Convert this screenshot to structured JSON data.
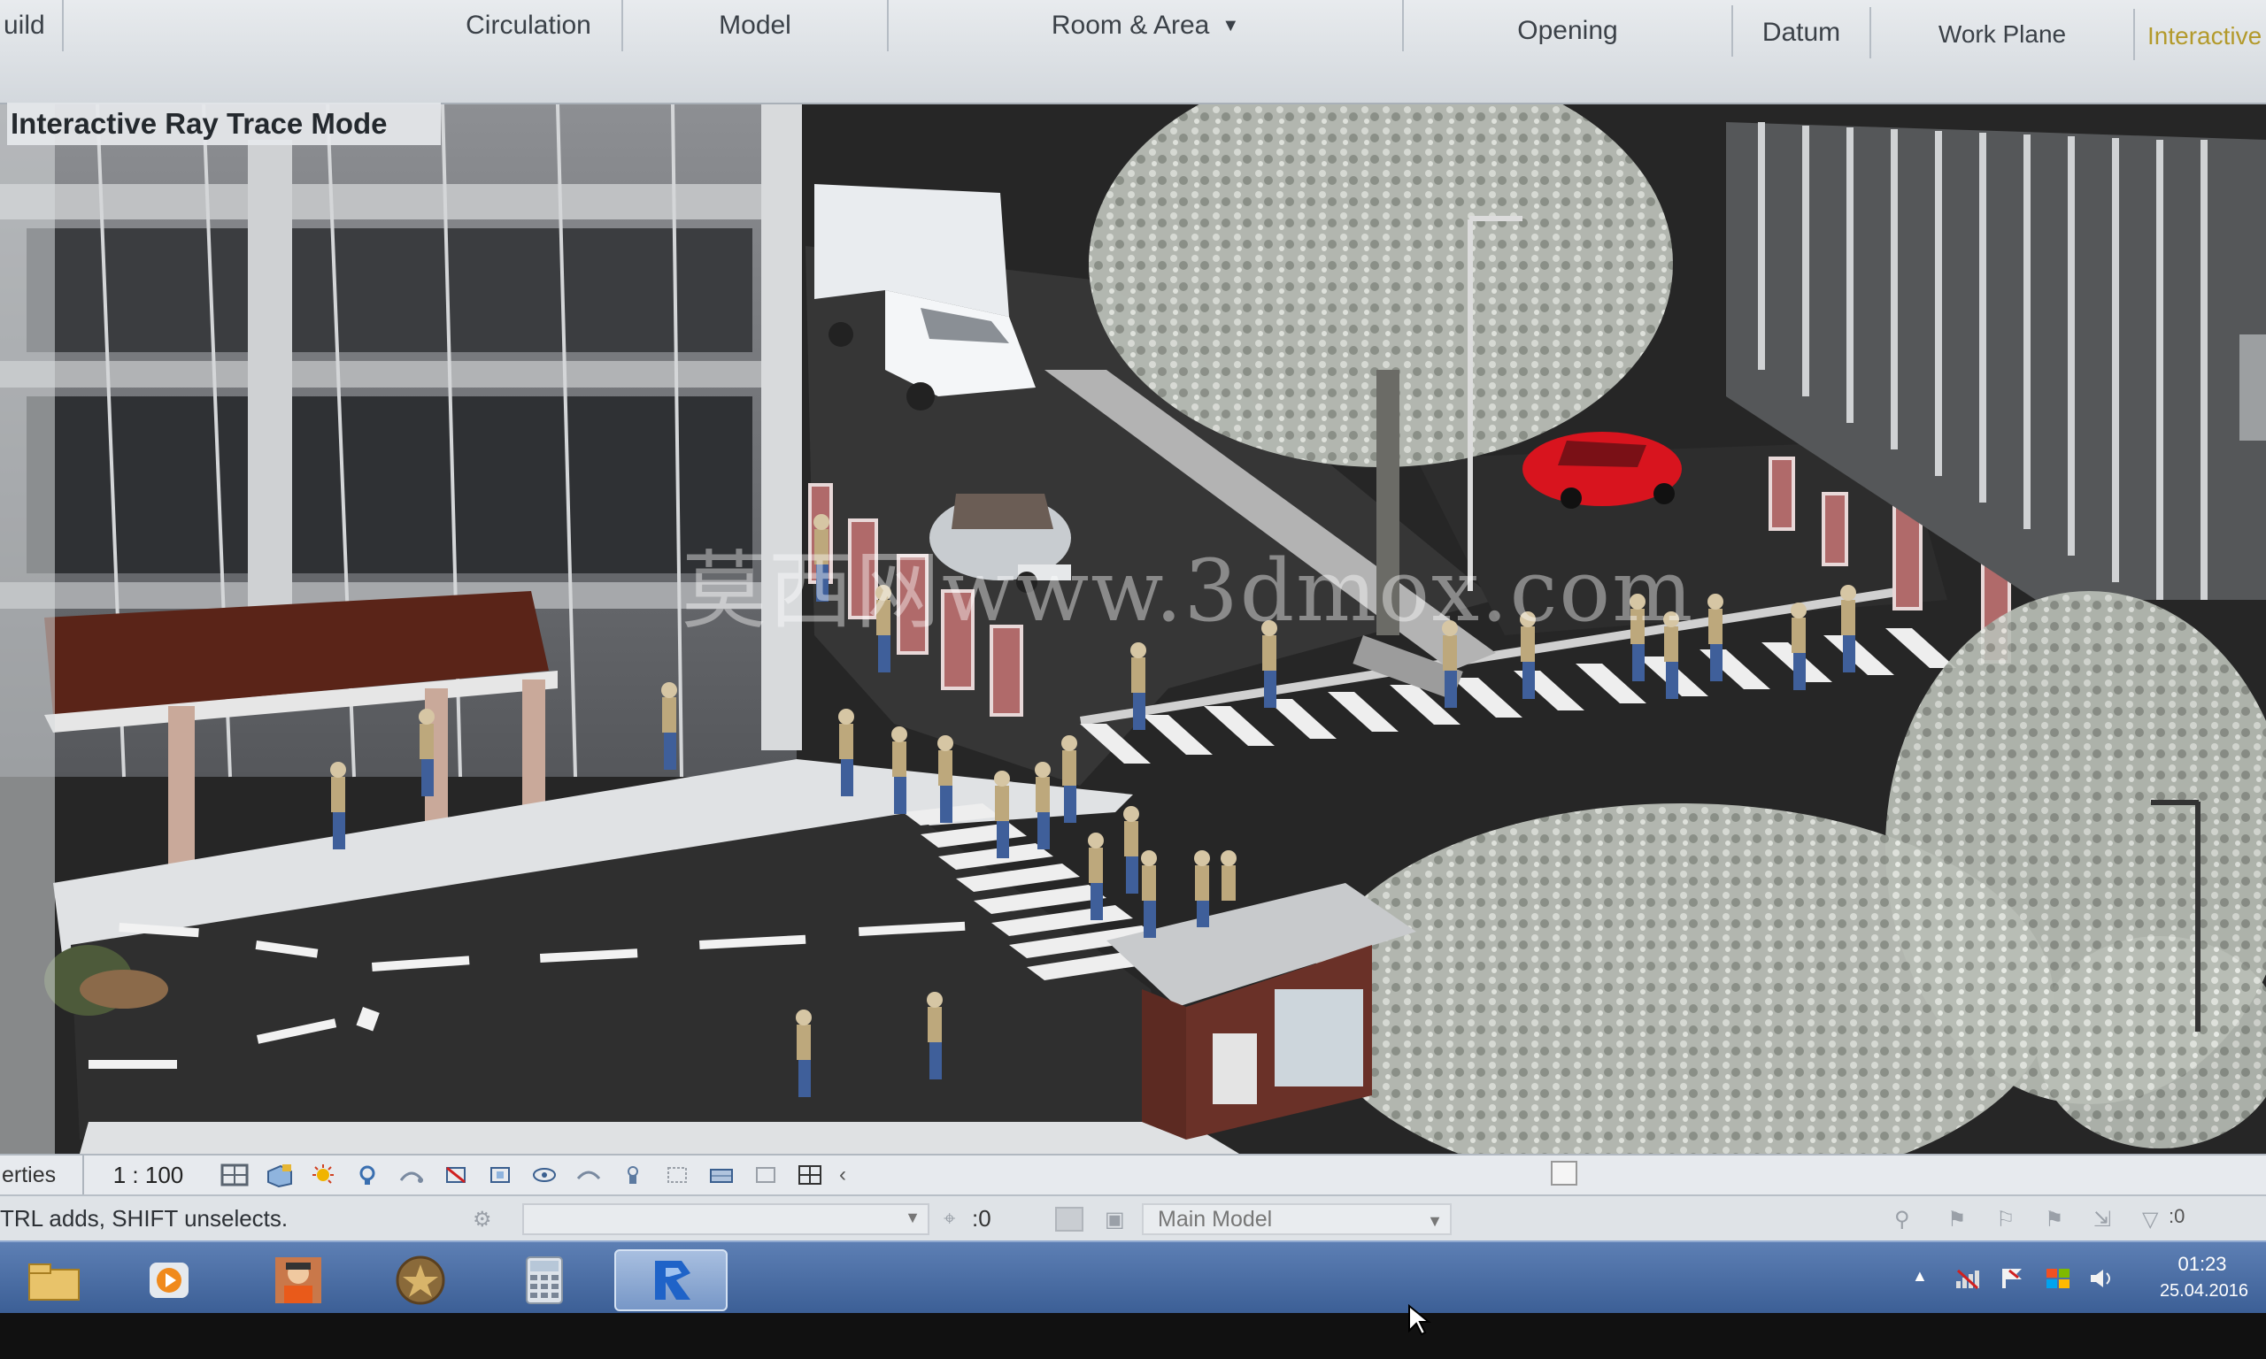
{
  "ribbon": {
    "panels": [
      {
        "label": "uild"
      },
      {
        "label": "Circulation"
      },
      {
        "label": "Model"
      },
      {
        "label": "Room & Area"
      },
      {
        "label": "Opening"
      },
      {
        "label": "Datum"
      },
      {
        "label": "Work Plane"
      },
      {
        "label": "Interactive"
      }
    ]
  },
  "view": {
    "title": "Interactive Ray Trace Mode",
    "watermark": "莫西网www.3dmox.com"
  },
  "view_control_bar": {
    "properties_tab": "erties",
    "scale": "1 : 100",
    "icons": [
      "detail-level-icon",
      "visual-style-icon",
      "sun-path-icon",
      "shadows-icon",
      "render-icon",
      "crop-view-icon",
      "show-crop-icon",
      "temporary-hide-icon",
      "reveal-hidden-icon",
      "lock-3d-icon",
      "analysis-icon",
      "highlight-icon",
      "constraints-icon",
      "worksharing-icon"
    ]
  },
  "status_bar": {
    "text": "TRL adds, SHIFT unselects.",
    "editable_count": ":0",
    "model_select": "Main Model",
    "filter_count": ":0"
  },
  "taskbar": {
    "apps": [
      "file-explorer-icon",
      "media-player-icon",
      "user-app-icon",
      "star-app-icon",
      "calculator-icon",
      "revit-icon"
    ],
    "clock_time": "01:23",
    "clock_date": "25.04.2016"
  },
  "colors": {
    "ribbon_bg": "#dde1e5",
    "taskbar": "#4a6ea6",
    "asphalt": "#2f2f2f",
    "car_red": "#d8141e"
  }
}
